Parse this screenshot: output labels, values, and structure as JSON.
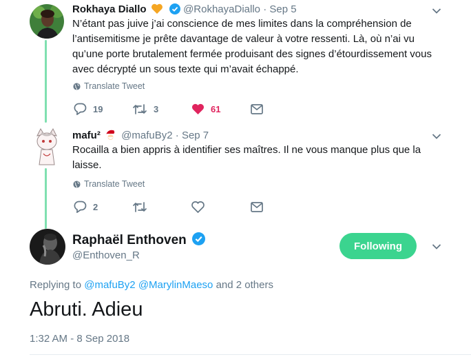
{
  "tweets": [
    {
      "name": "Rokhaya Diallo",
      "handle": "@RokhayaDiallo",
      "separator": "·",
      "date": "Sep 5",
      "text": "N’étant pas juive j’ai conscience de mes limites dans la compréhension de l’antisemitisme je prête davantage de valeur à votre ressenti. Là, où n’ai vu qu’une porte brutalement fermée produisant des signes d’étourdissement vous avec décrypté un sous texte qui m’avait échappé.",
      "translate": "Translate Tweet",
      "replies": "19",
      "retweets": "3",
      "likes": "61"
    },
    {
      "name": "mafu²",
      "handle": "@mafuBy2",
      "separator": "·",
      "date": "Sep 7",
      "text": "Rocailla a bien appris à identifier ses maîtres. Il ne vous manque plus que la laisse.",
      "translate": "Translate Tweet",
      "replies": "2"
    }
  ],
  "main_tweet": {
    "name": "Raphaël Enthoven",
    "handle": "@Enthoven_R",
    "follow_label": "Following",
    "replying_prefix": "Replying to",
    "replying_user1": "@mafuBy2",
    "replying_user2": "@MarylinMaeso",
    "replying_suffix": "and 2 others",
    "text": "Abruti. Adieu",
    "timestamp": "1:32 AM - 8 Sep 2018"
  },
  "colors": {
    "accent": "#1da1f2",
    "follow_button": "#3bd48f",
    "like_active": "#e0245e",
    "thread_line": "#7fe0b0",
    "muted": "#657786"
  },
  "icons": [
    "reply-icon",
    "retweet-icon",
    "like-icon",
    "dm-icon",
    "globe-icon",
    "verified-icon",
    "caret-icon",
    "heart-emoji-icon",
    "santa-emoji-icon"
  ]
}
